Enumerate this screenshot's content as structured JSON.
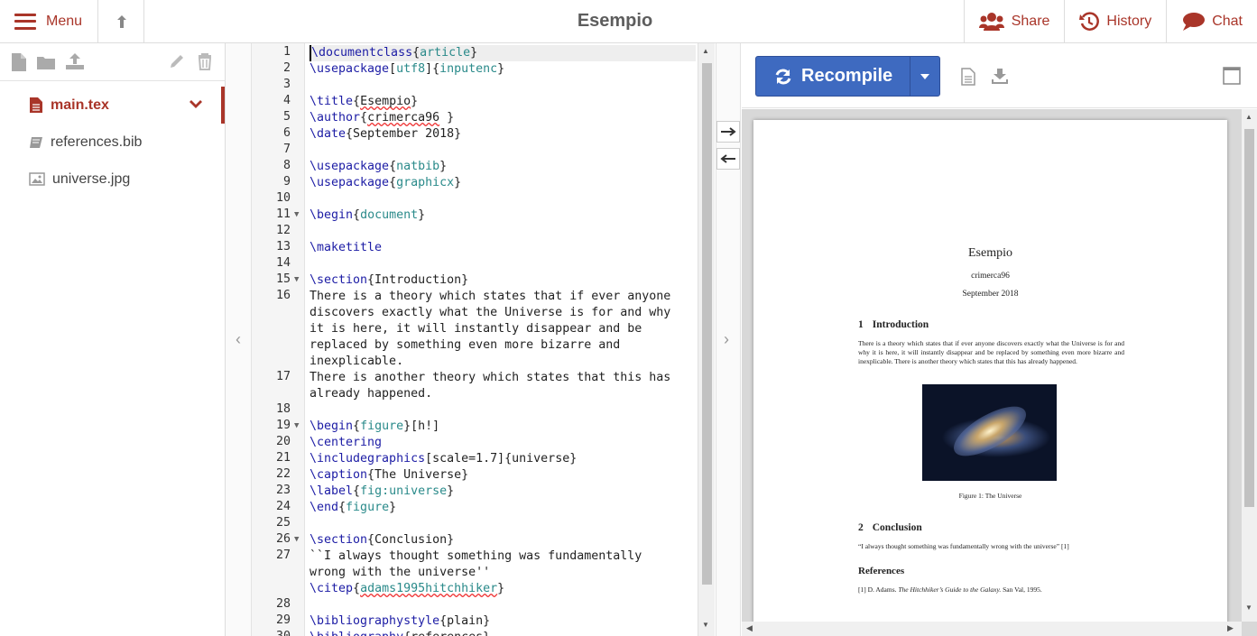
{
  "header": {
    "menu_label": "Menu",
    "project_title": "Esempio",
    "share_label": "Share",
    "history_label": "History",
    "chat_label": "Chat"
  },
  "colors": {
    "accent": "#a93529",
    "recompile": "#3e6ac0"
  },
  "file_tree": {
    "files": [
      {
        "name": "main.tex",
        "icon": "tex-file-icon",
        "active": true
      },
      {
        "name": "references.bib",
        "icon": "book-icon",
        "active": false
      },
      {
        "name": "universe.jpg",
        "icon": "image-icon",
        "active": false
      }
    ]
  },
  "editor": {
    "lines": [
      {
        "n": "1",
        "text": "\\documentclass{article}"
      },
      {
        "n": "2",
        "text": "\\usepackage[utf8]{inputenc}"
      },
      {
        "n": "3",
        "text": ""
      },
      {
        "n": "4",
        "text": "\\title{Esempio}"
      },
      {
        "n": "5",
        "text": "\\author{crimerca96 }"
      },
      {
        "n": "6",
        "text": "\\date{September 2018}"
      },
      {
        "n": "7",
        "text": ""
      },
      {
        "n": "8",
        "text": "\\usepackage{natbib}"
      },
      {
        "n": "9",
        "text": "\\usepackage{graphicx}"
      },
      {
        "n": "10",
        "text": ""
      },
      {
        "n": "11",
        "text": "\\begin{document}"
      },
      {
        "n": "12",
        "text": ""
      },
      {
        "n": "13",
        "text": "\\maketitle"
      },
      {
        "n": "14",
        "text": ""
      },
      {
        "n": "15",
        "text": "\\section{Introduction}"
      },
      {
        "n": "16",
        "text": "There is a theory which states that if ever anyone\ndiscovers exactly what the Universe is for and why\nit is here, it will instantly disappear and be\nreplaced by something even more bizarre and\ninexplicable."
      },
      {
        "n": "17",
        "text": "There is another theory which states that this has\nalready happened."
      },
      {
        "n": "18",
        "text": ""
      },
      {
        "n": "19",
        "text": "\\begin{figure}[h!]"
      },
      {
        "n": "20",
        "text": "\\centering"
      },
      {
        "n": "21",
        "text": "\\includegraphics[scale=1.7]{universe}"
      },
      {
        "n": "22",
        "text": "\\caption{The Universe}"
      },
      {
        "n": "23",
        "text": "\\label{fig:universe}"
      },
      {
        "n": "24",
        "text": "\\end{figure}"
      },
      {
        "n": "25",
        "text": ""
      },
      {
        "n": "26",
        "text": "\\section{Conclusion}"
      },
      {
        "n": "27",
        "text": "``I always thought something was fundamentally\nwrong with the universe''\n\\citep{adams1995hitchhiker}"
      },
      {
        "n": "28",
        "text": ""
      },
      {
        "n": "29",
        "text": "\\bibliographystyle{plain}"
      },
      {
        "n": "30",
        "text": "\\bibliography{references}"
      }
    ]
  },
  "preview": {
    "recompile_label": "Recompile",
    "doc": {
      "title": "Esempio",
      "author": "crimerca96",
      "date": "September 2018",
      "sec1_num": "1",
      "sec1_title": "Introduction",
      "sec1_body": "There is a theory which states that if ever anyone discovers exactly what the Universe is for and why it is here, it will instantly disappear and be replaced by something even more bizarre and inexplicable. There is another theory which states that this has already happened.",
      "caption": "Figure 1: The Universe",
      "sec2_num": "2",
      "sec2_title": "Conclusion",
      "sec2_body": "“I always thought something was fundamentally wrong with the universe” [1]",
      "refs_title": "References",
      "ref1_prefix": "[1] D. Adams. ",
      "ref1_title": "The Hitchhiker’s Guide to the Galaxy.",
      "ref1_suffix": " San Val, 1995."
    }
  }
}
